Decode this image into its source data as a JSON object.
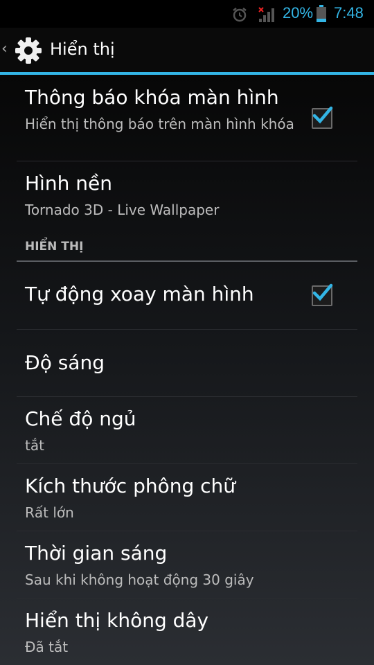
{
  "status_bar": {
    "battery": "20%",
    "time": "7:48",
    "icons": [
      "alarm-icon",
      "signal-icon",
      "battery-icon"
    ]
  },
  "action_bar": {
    "title": "Hiển thị",
    "icons": [
      "back-chevron-icon",
      "gear-icon"
    ]
  },
  "settings": {
    "lock_notification": {
      "title": "Thông báo khóa màn hình",
      "subtitle": "Hiển thị thông báo trên màn hình khóa",
      "checked": true
    },
    "wallpaper": {
      "title": "Hình nền",
      "subtitle": "Tornado 3D - Live Wallpaper"
    },
    "section_display": "HIỂN THỊ",
    "auto_rotate": {
      "title": "Tự động xoay màn hình",
      "checked": true
    },
    "brightness": {
      "title": "Độ sáng"
    },
    "sleep": {
      "title": "Chế độ ngủ",
      "subtitle": "tắt"
    },
    "font_size": {
      "title": "Kích thước phông chữ",
      "subtitle": "Rất lớn"
    },
    "screen_timeout": {
      "title": "Thời gian sáng",
      "subtitle": "Sau khi không hoạt động 30 giây"
    },
    "wireless_display": {
      "title": "Hiển thị không dây",
      "subtitle": "Đã tắt"
    }
  },
  "colors": {
    "accent": "#33b5e5",
    "background": "#000000",
    "subtitle": "#bdbdbd"
  }
}
